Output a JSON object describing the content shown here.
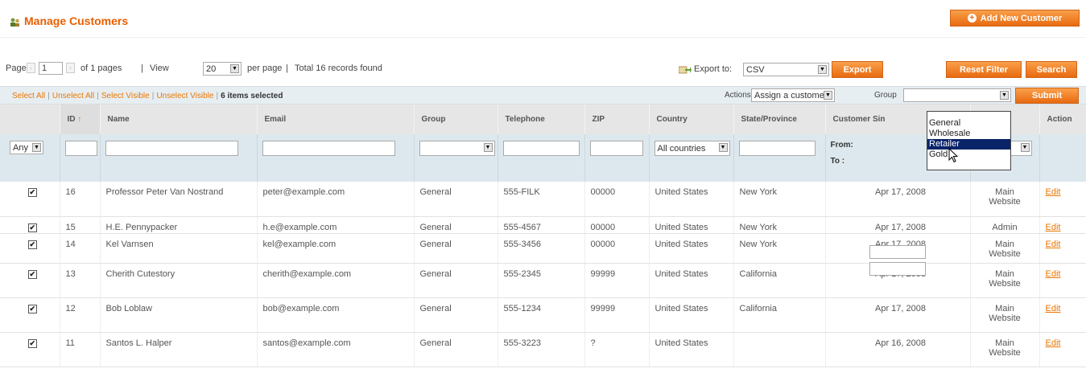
{
  "header": {
    "title": "Manage Customers",
    "add_button": "Add New Customer"
  },
  "pager": {
    "page_label": "Page",
    "page_value": "1",
    "of_pages": "of 1 pages",
    "sep": "|",
    "view_label": "View",
    "view_value": "20",
    "per_page": "per page",
    "total": "Total 16 records found",
    "export_label": "Export to:",
    "export_value": "CSV",
    "export_button": "Export",
    "reset_button": "Reset Filter",
    "search_button": "Search"
  },
  "massaction": {
    "select_all": "Select All",
    "unselect_all": "Unselect All",
    "select_visible": "Select Visible",
    "unselect_visible": "Unselect Visible",
    "selected_count": "6 items selected",
    "actions_label": "Actions",
    "actions_value": "Assign a custome",
    "group_label": "Group",
    "group_value": "",
    "submit_button": "Submit"
  },
  "columns": {
    "id": "ID",
    "name": "Name",
    "email": "Email",
    "group": "Group",
    "telephone": "Telephone",
    "zip": "ZIP",
    "country": "Country",
    "state": "State/Province",
    "since": "Customer Sin",
    "website": "e",
    "action": "Action"
  },
  "filters": {
    "any": "Any",
    "country": "All countries",
    "from": "From:",
    "to": "To :"
  },
  "group_options": [
    "General",
    "Wholesale",
    "Retailer",
    "Gold"
  ],
  "rows": [
    {
      "checked": "✔",
      "id": "16",
      "name": "Professor Peter Van Nostrand",
      "email": "peter@example.com",
      "group": "General",
      "telephone": "555-FILK",
      "zip": "00000",
      "country": "United States",
      "state": "New York",
      "since": "Apr 17, 2008",
      "website": "Main Website",
      "action": "Edit"
    },
    {
      "checked": "✔",
      "id": "15",
      "name": "H.E. Pennypacker",
      "email": "h.e@example.com",
      "group": "General",
      "telephone": "555-4567",
      "zip": "00000",
      "country": "United States",
      "state": "New York",
      "since": "Apr 17, 2008",
      "website": "Admin",
      "action": "Edit"
    },
    {
      "checked": "✔",
      "id": "14",
      "name": "Kel Varnsen",
      "email": "kel@example.com",
      "group": "General",
      "telephone": "555-3456",
      "zip": "00000",
      "country": "United States",
      "state": "New York",
      "since": "Apr 17, 2008",
      "website": "Main Website",
      "action": "Edit"
    },
    {
      "checked": "✔",
      "id": "13",
      "name": "Cherith Cutestory",
      "email": "cherith@example.com",
      "group": "General",
      "telephone": "555-2345",
      "zip": "99999",
      "country": "United States",
      "state": "California",
      "since": "Apr 17, 2008",
      "website": "Main Website",
      "action": "Edit"
    },
    {
      "checked": "✔",
      "id": "12",
      "name": "Bob Loblaw",
      "email": "bob@example.com",
      "group": "General",
      "telephone": "555-1234",
      "zip": "99999",
      "country": "United States",
      "state": "California",
      "since": "Apr 17, 2008",
      "website": "Main Website",
      "action": "Edit"
    },
    {
      "checked": "✔",
      "id": "11",
      "name": "Santos L. Halper",
      "email": "santos@example.com",
      "group": "General",
      "telephone": "555-3223",
      "zip": "?",
      "country": "United States",
      "state": "",
      "since": "Apr 16, 2008",
      "website": "Main Website",
      "action": "Edit"
    }
  ]
}
